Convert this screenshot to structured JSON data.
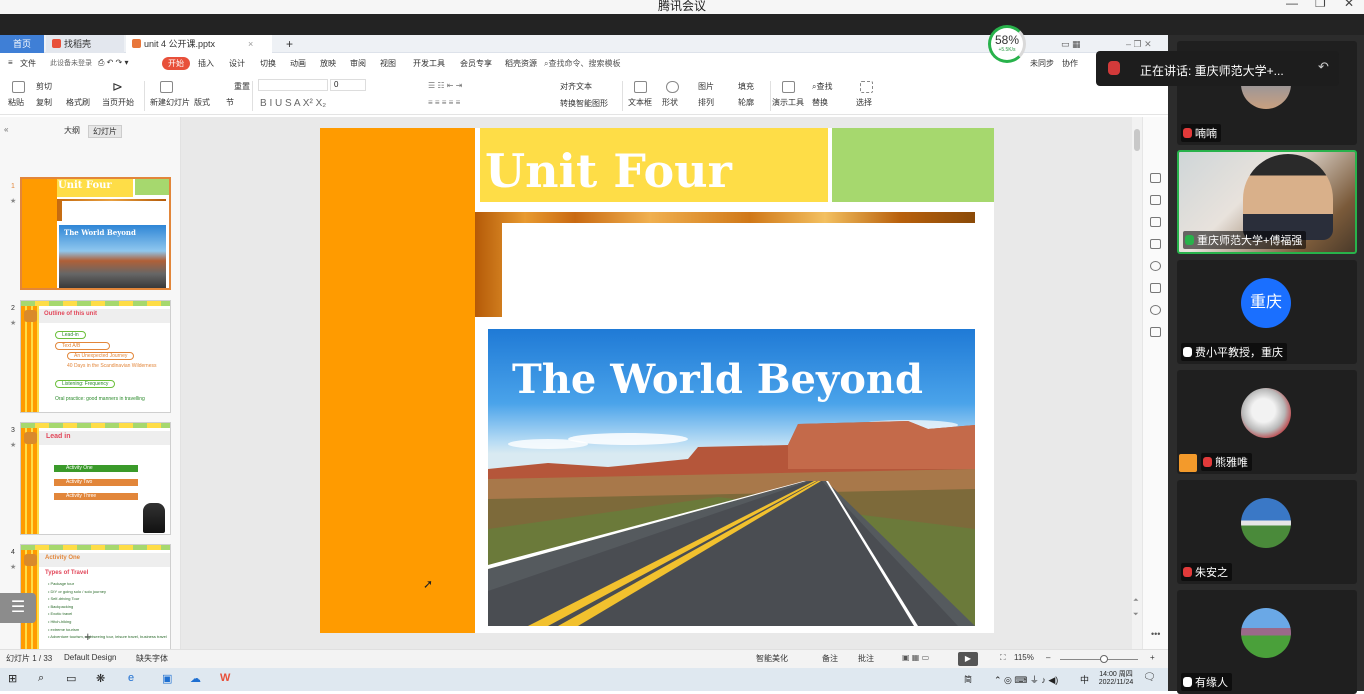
{
  "meeting": {
    "title": "腾讯会议",
    "speaker_banner": "正在讲话: 重庆师范大学+...",
    "participants": [
      {
        "name": "喃喃",
        "mic": "muted"
      },
      {
        "name": "重庆师范大学+傅福强",
        "mic": "active"
      },
      {
        "name": "费小平教授，重庆",
        "mic": "on",
        "avatar_text": "重庆"
      },
      {
        "name": "熊雅唯",
        "mic": "muted"
      },
      {
        "name": "朱安之",
        "mic": "muted"
      },
      {
        "name": "有缘人",
        "mic": "on"
      }
    ]
  },
  "wps": {
    "tabs": {
      "home": "首页",
      "daoke": "找稻壳",
      "doc": "unit 4 公开课.pptx",
      "add": "+"
    },
    "menu": {
      "file": "文件",
      "items": [
        "开始",
        "插入",
        "设计",
        "切换",
        "动画",
        "放映",
        "审阅",
        "视图",
        "开发工具",
        "会员专享",
        "稻壳资源"
      ],
      "search": "查找命令、搜索模板",
      "sync": "未同步",
      "collab": "协作",
      "account": "此设备未登录"
    },
    "memory": {
      "percent": "58%",
      "speed": "+5.5K/s"
    },
    "ribbon": {
      "paste": "粘贴",
      "cut": "剪切",
      "copy": "复制",
      "format_painter": "格式刷",
      "play": "当页开始",
      "new_slide": "新建幻灯片",
      "layout": "版式",
      "section": "节",
      "reset": "重置",
      "font_size": "0",
      "textbox": "文本框",
      "shape": "形状",
      "arrange": "排列",
      "picture": "图片",
      "fill": "填充",
      "outline": "轮廓",
      "smartart": "转换智能图形",
      "align": "对齐文本",
      "presenter_tools": "演示工具",
      "find": "查找",
      "replace": "替换",
      "select": "选择"
    },
    "panel": {
      "outline_tab": "大纲",
      "slides_tab": "幻灯片"
    },
    "thumbnails": [
      {
        "num": "1",
        "title": "Unit Four",
        "subtitle": "The World Beyond"
      },
      {
        "num": "2",
        "title": "Outline of this unit",
        "items": [
          "Lead-in",
          "Text A/B",
          "An Unexpected Journey",
          "40 Days in the Scandinavian Wilderness",
          "Listening: Frequency",
          "Oral practice: good manners in travelling"
        ]
      },
      {
        "num": "3",
        "title": "Lead in",
        "items": [
          "Activity One",
          "Activity Two",
          "Activity Three"
        ]
      },
      {
        "num": "4",
        "title": "Activity One",
        "heading": "Types of Travel",
        "items": [
          "Package tour",
          "DIY or going solo / solo journey",
          "Self-driving Tour",
          "Backpacking",
          "Exotic travel",
          "Hitch-hiking",
          "extreme tourism",
          "Adventure tourism, sightseeing tour, leisure travel, business travel"
        ]
      }
    ],
    "slide": {
      "title": "Unit Four",
      "subtitle": "The World Beyond"
    },
    "status": {
      "slide_counter": "幻灯片 1 / 33",
      "design": "Default Design",
      "missing_fonts": "缺失字体",
      "beautify": "智能美化",
      "notes": "备注",
      "comments": "批注",
      "zoom": "115%"
    },
    "taskbar": {
      "clock_time": "14:00 周四",
      "clock_date": "2022/11/24",
      "ime": "中",
      "layout_label": "简"
    }
  },
  "colors": {
    "orange": "#ff9b00",
    "yellow": "#fedd47",
    "green": "#a6d86e",
    "accent": "#e8503a"
  }
}
